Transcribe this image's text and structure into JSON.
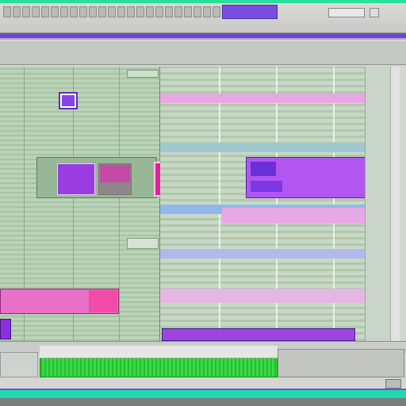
{
  "title_bar": {
    "title": ""
  },
  "toolbar": {
    "buttons": [
      "",
      "",
      "",
      "",
      "",
      "",
      "",
      "",
      "",
      "",
      "",
      "",
      "",
      "",
      "",
      "",
      "",
      "",
      "",
      "",
      "",
      "",
      ""
    ],
    "pattern_selector": "",
    "counter": ""
  },
  "colors": {
    "accent_green": "#28e09a",
    "accent_purple": "#6c48c8",
    "clip_pink": "#e870c8",
    "clip_purple": "#b256f2",
    "note_magenta": "#e0209e",
    "track_green": "#22c02c"
  },
  "icons": {
    "playlist_marker": "square-marker-icon",
    "channel_pad": "pad-icon",
    "scroll": "scrollbar-icon"
  }
}
